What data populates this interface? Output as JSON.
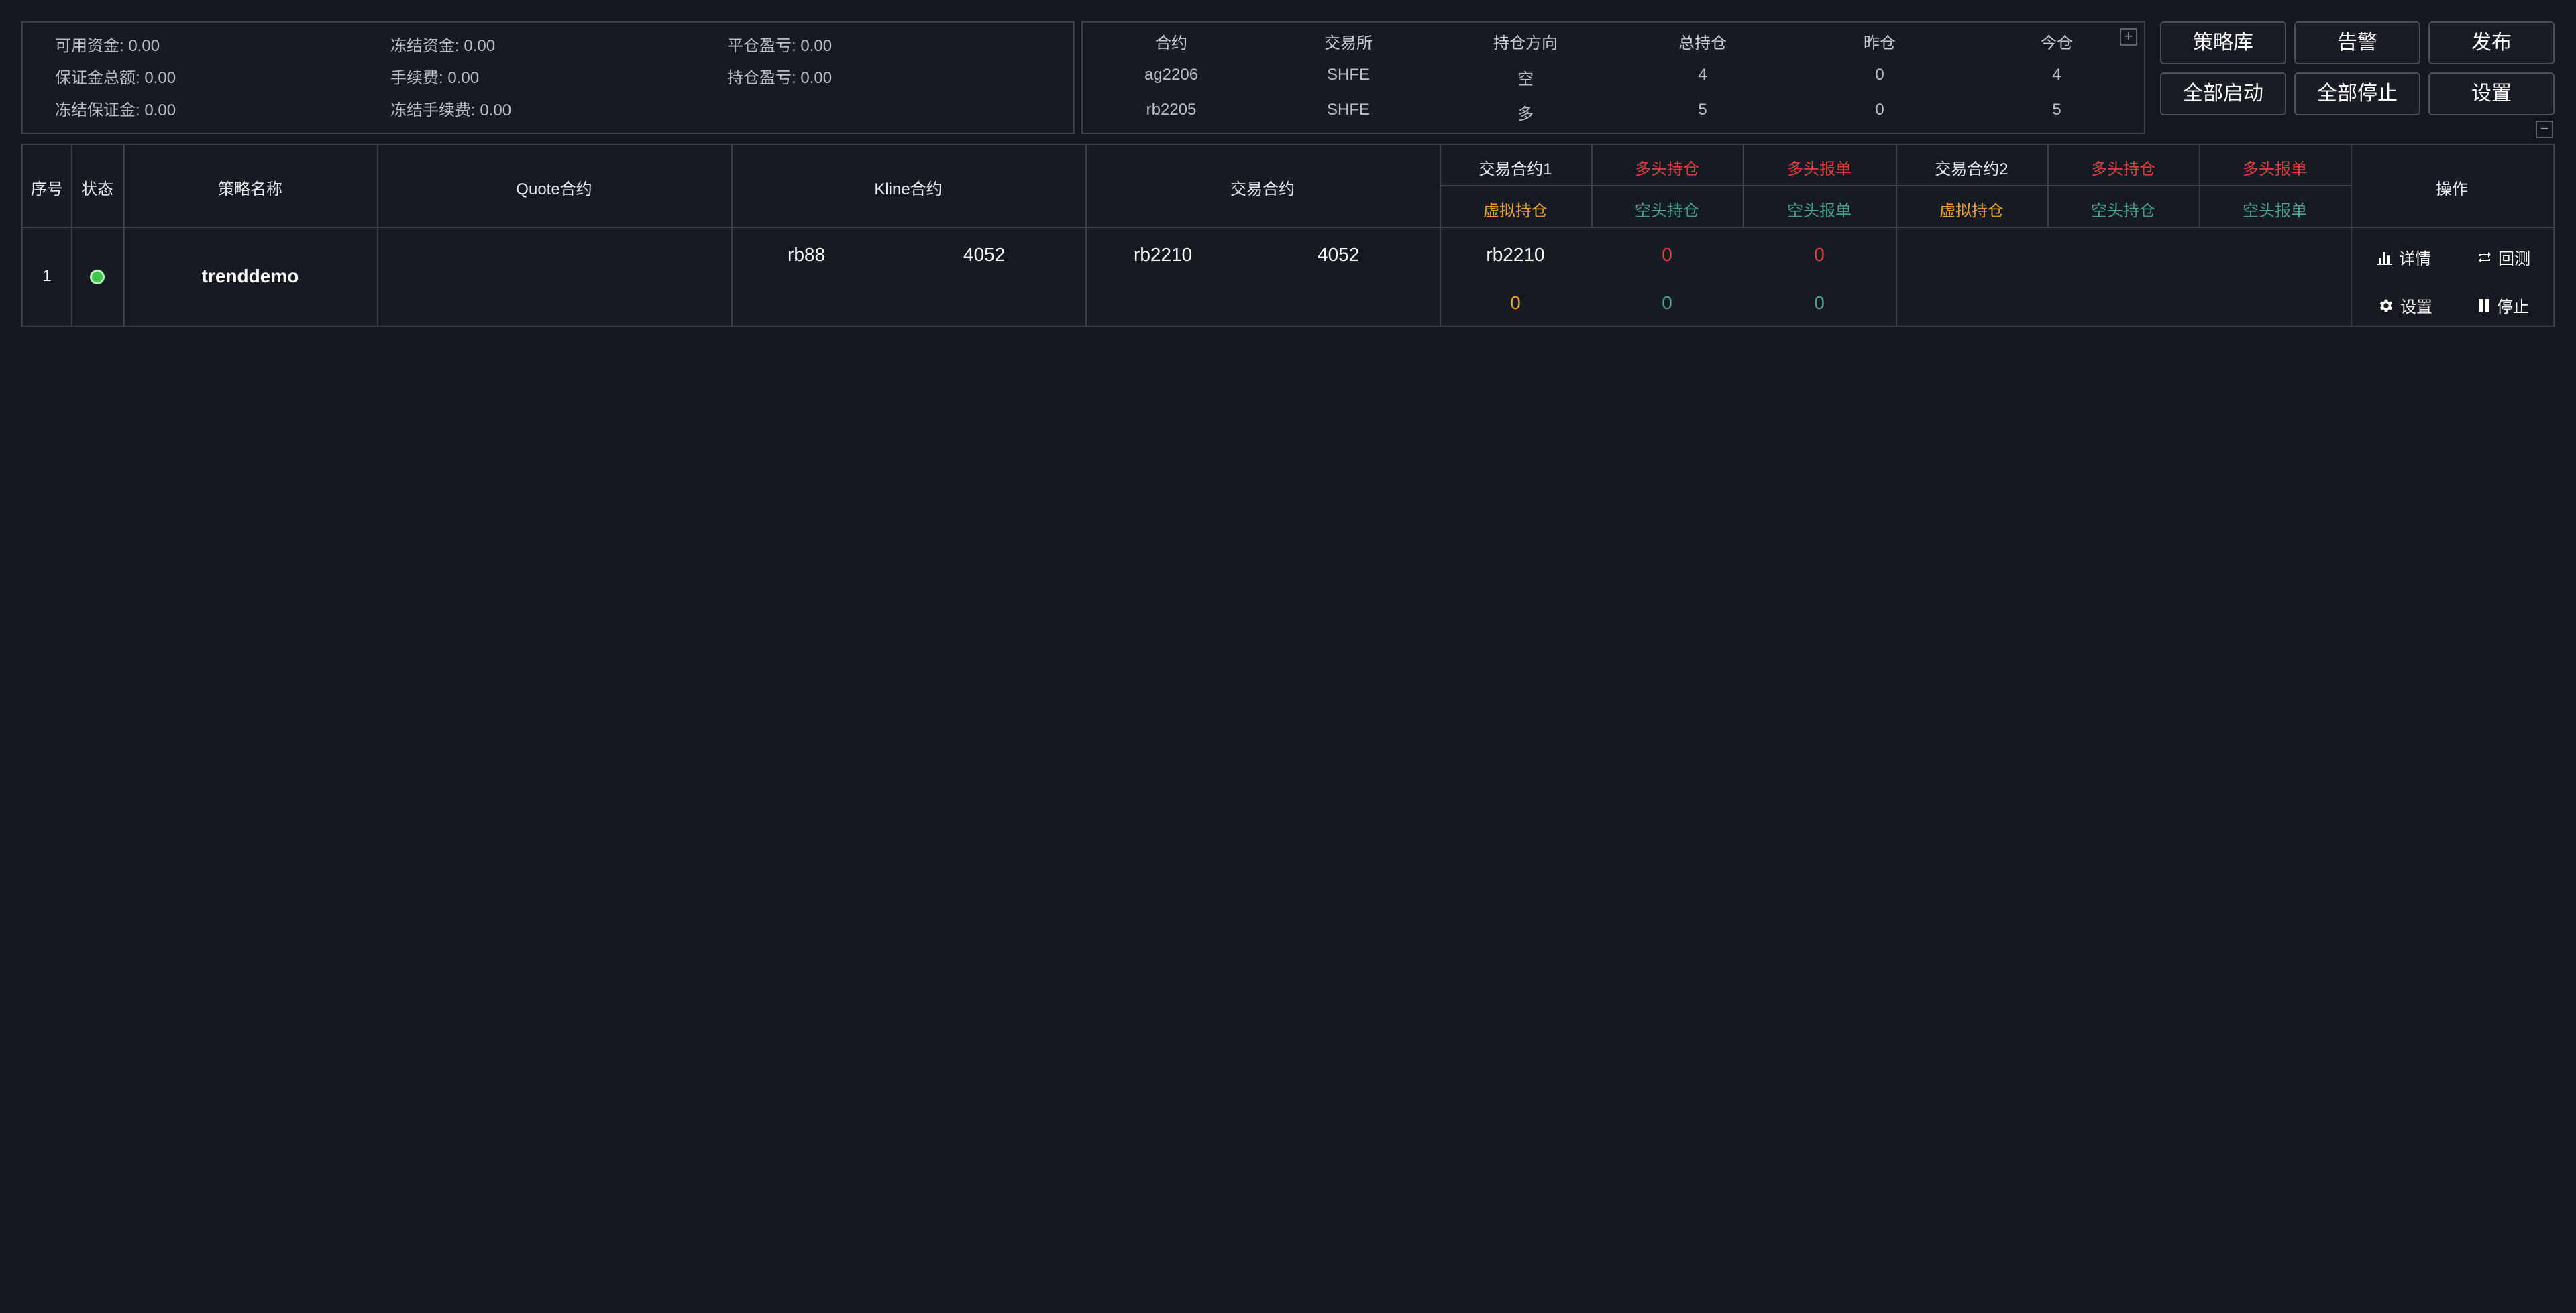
{
  "account": {
    "available_funds": "可用资金: 0.00",
    "frozen_funds": "冻结资金: 0.00",
    "close_pnl": "平仓盈亏: 0.00",
    "total_margin": "保证金总额: 0.00",
    "fee": "手续费: 0.00",
    "position_pnl": "持仓盈亏: 0.00",
    "frozen_margin": "冻结保证金: 0.00",
    "frozen_fee": "冻结手续费: 0.00"
  },
  "positions": {
    "headers": [
      "合约",
      "交易所",
      "持仓方向",
      "总持仓",
      "昨仓",
      "今仓"
    ],
    "rows": [
      [
        "ag2206",
        "SHFE",
        "空",
        "4",
        "0",
        "4"
      ],
      [
        "rb2205",
        "SHFE",
        "多",
        "5",
        "0",
        "5"
      ]
    ],
    "expand_label": "+",
    "collapse_label": "−"
  },
  "toolbar": {
    "strategy_lib": "策略库",
    "alert": "告警",
    "publish": "发布",
    "start_all": "全部启动",
    "stop_all": "全部停止",
    "settings": "设置"
  },
  "strategy_table": {
    "headers": {
      "index": "序号",
      "status": "状态",
      "name": "策略名称",
      "quote": "Quote合约",
      "kline": "Kline合约",
      "trade": "交易合约",
      "trade1": "交易合约1",
      "long_pos": "多头持仓",
      "long_order": "多头报单",
      "trade2": "交易合约2",
      "virtual_pos": "虚拟持仓",
      "short_pos": "空头持仓",
      "short_order": "空头报单",
      "ops": "操作"
    },
    "rows": [
      {
        "index": "1",
        "status": "running",
        "name": "trenddemo",
        "kline_symbol": "rb88",
        "kline_price": "4052",
        "trade_symbol": "rb2210",
        "trade_price": "4052",
        "t1_symbol": "rb2210",
        "t1_long_pos": "0",
        "t1_long_order": "0",
        "t1_virtual_pos": "0",
        "t1_short_pos": "0",
        "t1_short_order": "0"
      }
    ],
    "actions": {
      "detail": "详情",
      "backtest": "回测",
      "settings": "设置",
      "stop": "停止"
    }
  },
  "colors": {
    "background": "#141720",
    "border": "#3a3f4a",
    "long": "#e0403f",
    "short": "#4aa38f",
    "virtual": "#e8a22a",
    "status_running": "#3ec74b"
  }
}
